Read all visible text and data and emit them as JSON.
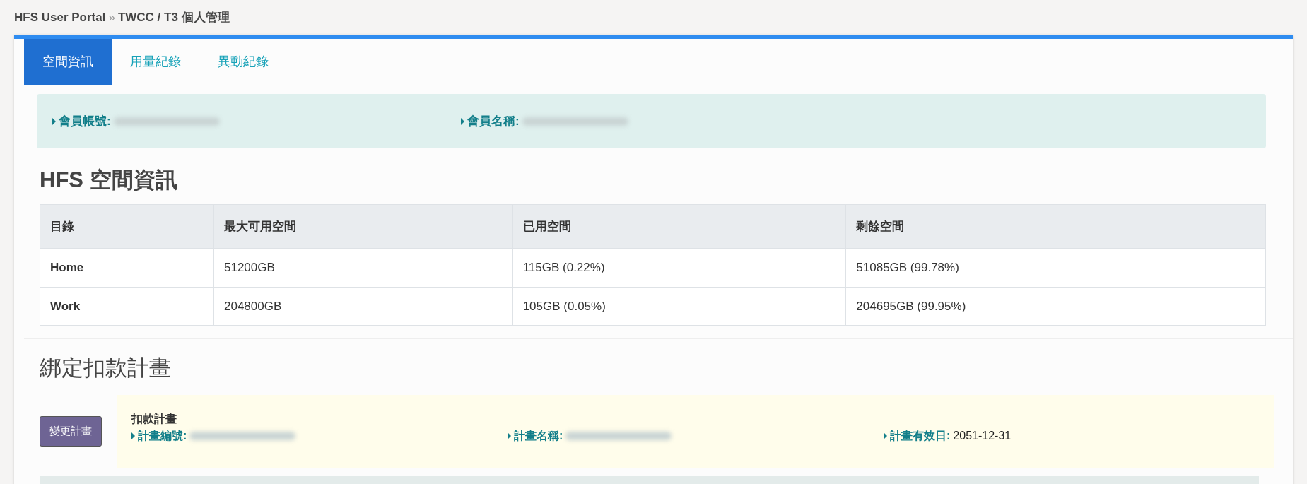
{
  "breadcrumb": {
    "root": "HFS User Portal",
    "separator": "»",
    "current": "TWCC / T3 個人管理"
  },
  "tabs": [
    {
      "label": "空間資訊",
      "selected": true
    },
    {
      "label": "用量紀錄",
      "selected": false
    },
    {
      "label": "異動紀錄",
      "selected": false
    }
  ],
  "member_info": [
    {
      "label": "會員帳號:",
      "blurred": true
    },
    {
      "label": "會員名稱:",
      "blurred": true
    }
  ],
  "space_section": {
    "title": "HFS 空間資訊",
    "table": {
      "columns": [
        "目錄",
        "最大可用空間",
        "已用空間",
        "剩餘空間"
      ],
      "rows": [
        [
          "Home",
          "51200GB",
          "115GB (0.22%)",
          "51085GB (99.78%)"
        ],
        [
          "Work",
          "204800GB",
          "105GB (0.05%)",
          "204695GB (99.95%)"
        ]
      ]
    }
  },
  "plan_section": {
    "title": "綁定扣款計畫",
    "button": "變更計畫",
    "plan_title": "扣款計畫",
    "fields": [
      {
        "label": "計畫編號:",
        "blurred": true
      },
      {
        "label": "計畫名稱:",
        "blurred": true
      },
      {
        "label": "計畫有效日:",
        "value": "2051-12-31",
        "blurred": false
      }
    ]
  }
}
